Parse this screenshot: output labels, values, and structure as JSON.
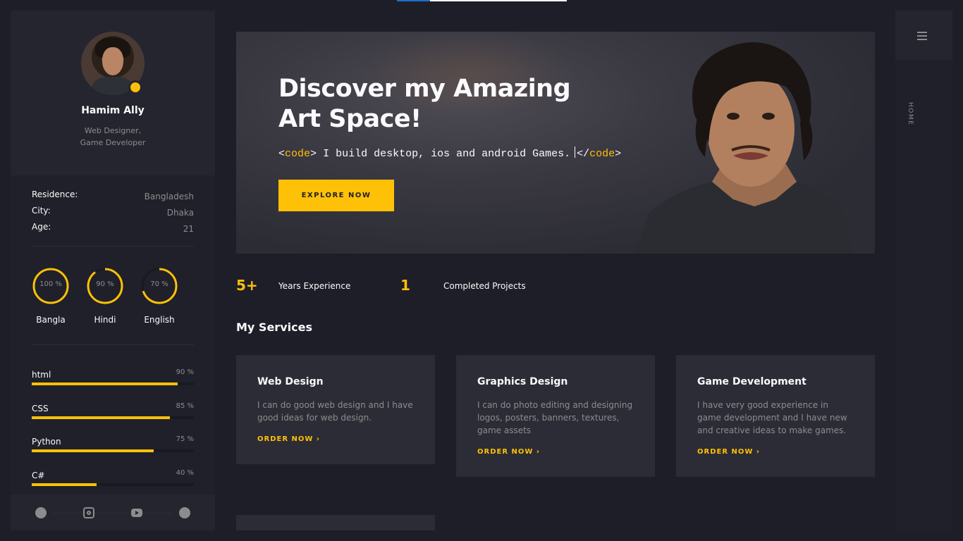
{
  "profile": {
    "name": "Hamim Ally",
    "role_line1": "Web Designer,",
    "role_line2": "Game Developer"
  },
  "info": [
    {
      "label": "Residence:",
      "value": "Bangladesh"
    },
    {
      "label": "City:",
      "value": "Dhaka"
    },
    {
      "label": "Age:",
      "value": "21"
    }
  ],
  "languages": [
    {
      "name": "Bangla",
      "percent_label": "100 %",
      "level": 100
    },
    {
      "name": "Hindi",
      "percent_label": "90 %",
      "level": 90
    },
    {
      "name": "English",
      "percent_label": "70 %",
      "level": 70
    }
  ],
  "skills": [
    {
      "name": "html",
      "percent_label": "90 %",
      "level": 90
    },
    {
      "name": "CSS",
      "percent_label": "85 %",
      "level": 85
    },
    {
      "name": "Python",
      "percent_label": "75 %",
      "level": 75
    },
    {
      "name": "C#",
      "percent_label": "40 %",
      "level": 40
    }
  ],
  "social": [
    "facebook-icon",
    "instagram-icon",
    "youtube-icon",
    "github-icon"
  ],
  "hero": {
    "title_line1": "Discover my Amazing",
    "title_line2": "Art Space!",
    "code_open": "<code>",
    "code_open_lt": "<",
    "code_kw": "code",
    "code_gt": ">",
    "code_text": "I build desktop, ios and android Games.",
    "code_close_lt": "</",
    "button": "EXPLORE NOW"
  },
  "stats": [
    {
      "number": "5+",
      "label": "Years Experience"
    },
    {
      "number": "1",
      "label": "Completed Projects"
    }
  ],
  "services": {
    "title": "My Services",
    "cards": [
      {
        "title": "Web Design",
        "desc": "I can do good web design and I have good ideas for web design.",
        "link": "ORDER NOW"
      },
      {
        "title": "Graphics Design",
        "desc": "I can do photo editing and designing logos, posters, banners, textures, game assets",
        "link": "ORDER NOW"
      },
      {
        "title": "Game Development",
        "desc": "I have very good experience in game development and I have new and creative ideas to make games.",
        "link": "ORDER NOW"
      }
    ]
  },
  "rail": {
    "home": "HOME",
    "menu_icon": "hamburger-icon"
  },
  "colors": {
    "accent": "#ffc107",
    "bg": "#1e1e28",
    "panel": "#20202a",
    "card": "#2c2c36",
    "muted": "#8c8c8e"
  }
}
